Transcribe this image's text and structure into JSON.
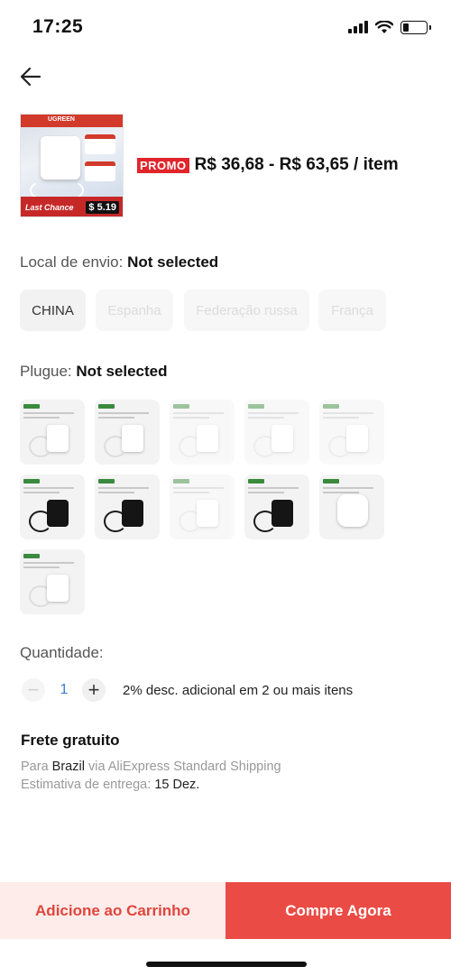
{
  "status": {
    "time": "17:25",
    "battery_level": 0.25
  },
  "product": {
    "thumb_brand": "UGREEN",
    "thumb_caption": "Last Chance",
    "thumb_price": "$ 5.19",
    "promo_badge": "PROMO",
    "price_range": "R$ 36,68 - R$ 63,65 / item"
  },
  "ship_from": {
    "label": "Local de envio:",
    "value": "Not selected",
    "options": [
      {
        "label": "CHINA",
        "enabled": true
      },
      {
        "label": "Espanha",
        "enabled": false
      },
      {
        "label": "Federação russa",
        "enabled": false
      },
      {
        "label": "França",
        "enabled": false
      }
    ]
  },
  "plug": {
    "label": "Plugue:",
    "value": "Not selected",
    "options": [
      {
        "color": "white",
        "enabled": true
      },
      {
        "color": "white",
        "enabled": true
      },
      {
        "color": "white",
        "enabled": false
      },
      {
        "color": "white",
        "enabled": false
      },
      {
        "color": "white",
        "enabled": false
      },
      {
        "color": "black",
        "enabled": true
      },
      {
        "color": "black",
        "enabled": true
      },
      {
        "color": "white",
        "enabled": false
      },
      {
        "color": "black",
        "enabled": true
      },
      {
        "color": "white-round",
        "enabled": true
      },
      {
        "color": "white",
        "enabled": true
      }
    ]
  },
  "quantity": {
    "label": "Quantidade:",
    "value": "1",
    "discount_note": "2% desc. adicional em 2 ou mais itens"
  },
  "shipping": {
    "title": "Frete gratuito",
    "to_prefix": "Para",
    "country": "Brazil",
    "via": "via AliExpress Standard Shipping",
    "estimate_label": "Estimativa de entrega:",
    "estimate_value": "15  Dez."
  },
  "actions": {
    "add_to_cart": "Adicione ao Carrinho",
    "buy_now": "Compre Agora"
  },
  "colors": {
    "accent": "#ea4b45",
    "promo": "#e0262b",
    "qty_value": "#3b7bd3"
  }
}
